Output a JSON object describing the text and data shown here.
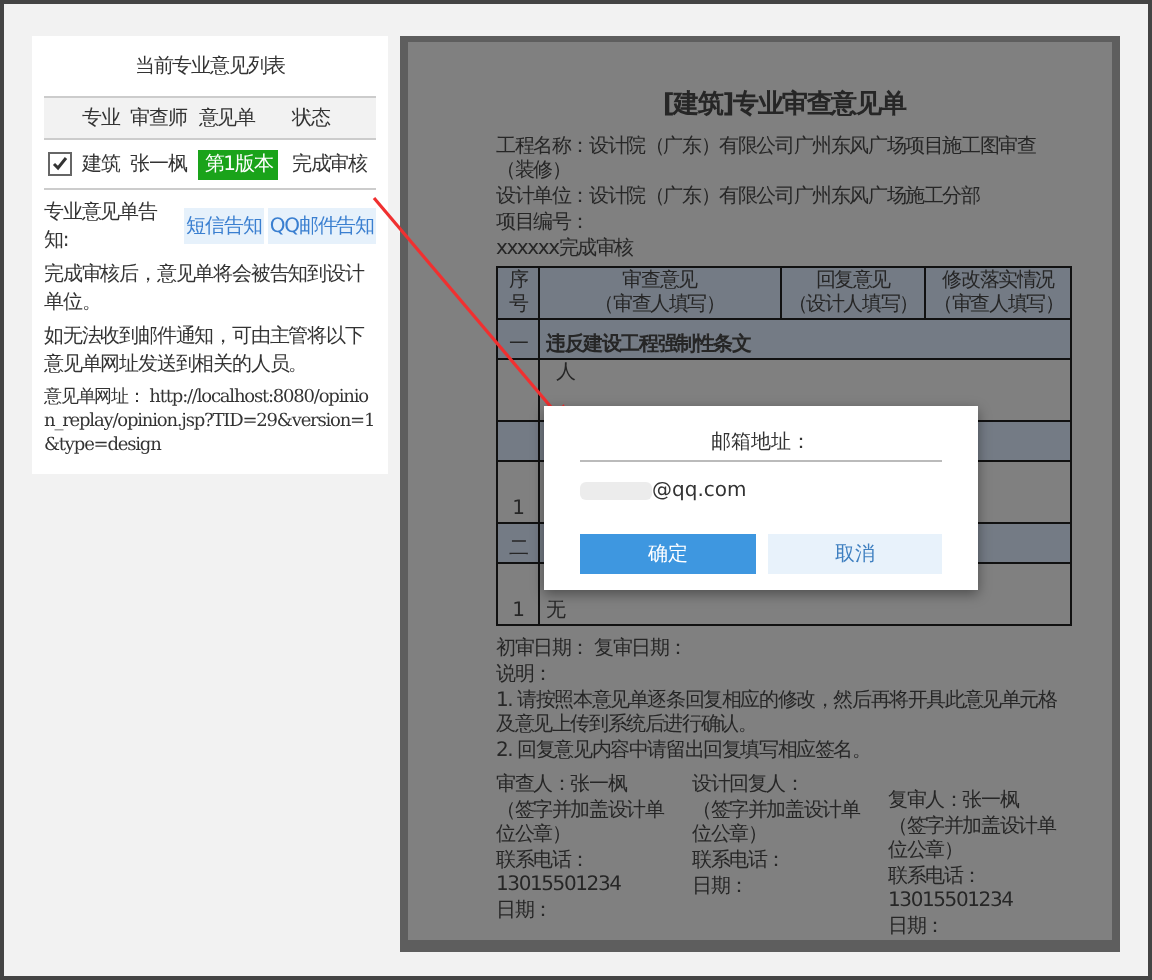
{
  "panel": {
    "title": "当前专业意见列表",
    "columns": [
      "专业",
      "审查师",
      "意见单",
      "状态"
    ],
    "rows": [
      {
        "checked": true,
        "discipline": "建筑",
        "reviewer": "张一枫",
        "version": "第1版本",
        "status": "完成审核"
      }
    ],
    "notify_label": "专业意见单告知:",
    "notify_buttons": [
      "短信告知",
      "QQ邮件告知"
    ],
    "notes": [
      "完成审核后，意见单将会被告知到设计单位。",
      "如无法收到邮件通知，可由主管将以下意见单网址发送到相关的人员。"
    ],
    "url_label": "意见单网址：",
    "url": "http://localhost:8080/opinion_replay/opinion.jsp?TID=29&version=1&type=design"
  },
  "document": {
    "title": "[建筑]专业审查意见单",
    "info": [
      "工程名称：设计院（广东）有限公司广州东风广场项目施工图审查（装修）",
      "设计单位：设计院（广东）有限公司广州东风广场施工分部",
      "项目编号：",
      "xxxxxx完成审核"
    ],
    "columns": [
      {
        "title": "序号"
      },
      {
        "title": "审查意见",
        "sub": "（审查人填写）"
      },
      {
        "title": "回复意见",
        "sub": "（设计人填写）"
      },
      {
        "title": "修改落实情况",
        "sub": "（审查人填写）"
      }
    ],
    "rows": [
      {
        "kind": "section",
        "number": "一",
        "text": "违反建设工程强制性条文"
      },
      {
        "kind": "item",
        "text": "人"
      },
      {
        "kind": "section"
      },
      {
        "kind": "item",
        "number": "1"
      },
      {
        "kind": "section",
        "number": "二"
      },
      {
        "kind": "item",
        "number": "1",
        "text": "无"
      }
    ],
    "dates": "初审日期：  复审日期：",
    "notes_title": "说明：",
    "notes": [
      "1. 请按照本意见单逐条回复相应的修改，然后再将开具此意见单元格及意见上传到系统后进行确认。",
      "2. 回复意见内容中请留出回复填写相应签名。"
    ],
    "signatures": [
      [
        "审查人：张一枫",
        "（签字并加盖设计单位公章）",
        "联系电话：13015501234",
        "日期："
      ],
      [
        "设计回复人：",
        "（签字并加盖设计单位公章）",
        "联系电话：",
        "日期："
      ],
      [
        "复审人：张一枫",
        "（签字并加盖设计单位公章）",
        "联系电话：13015501234",
        "日期："
      ]
    ]
  },
  "dialog": {
    "label": "邮箱地址：",
    "value": "@qq.com",
    "buttons": [
      {
        "label": "确定",
        "kind": "primary"
      },
      {
        "label": "取消",
        "kind": "secondary"
      }
    ]
  }
}
